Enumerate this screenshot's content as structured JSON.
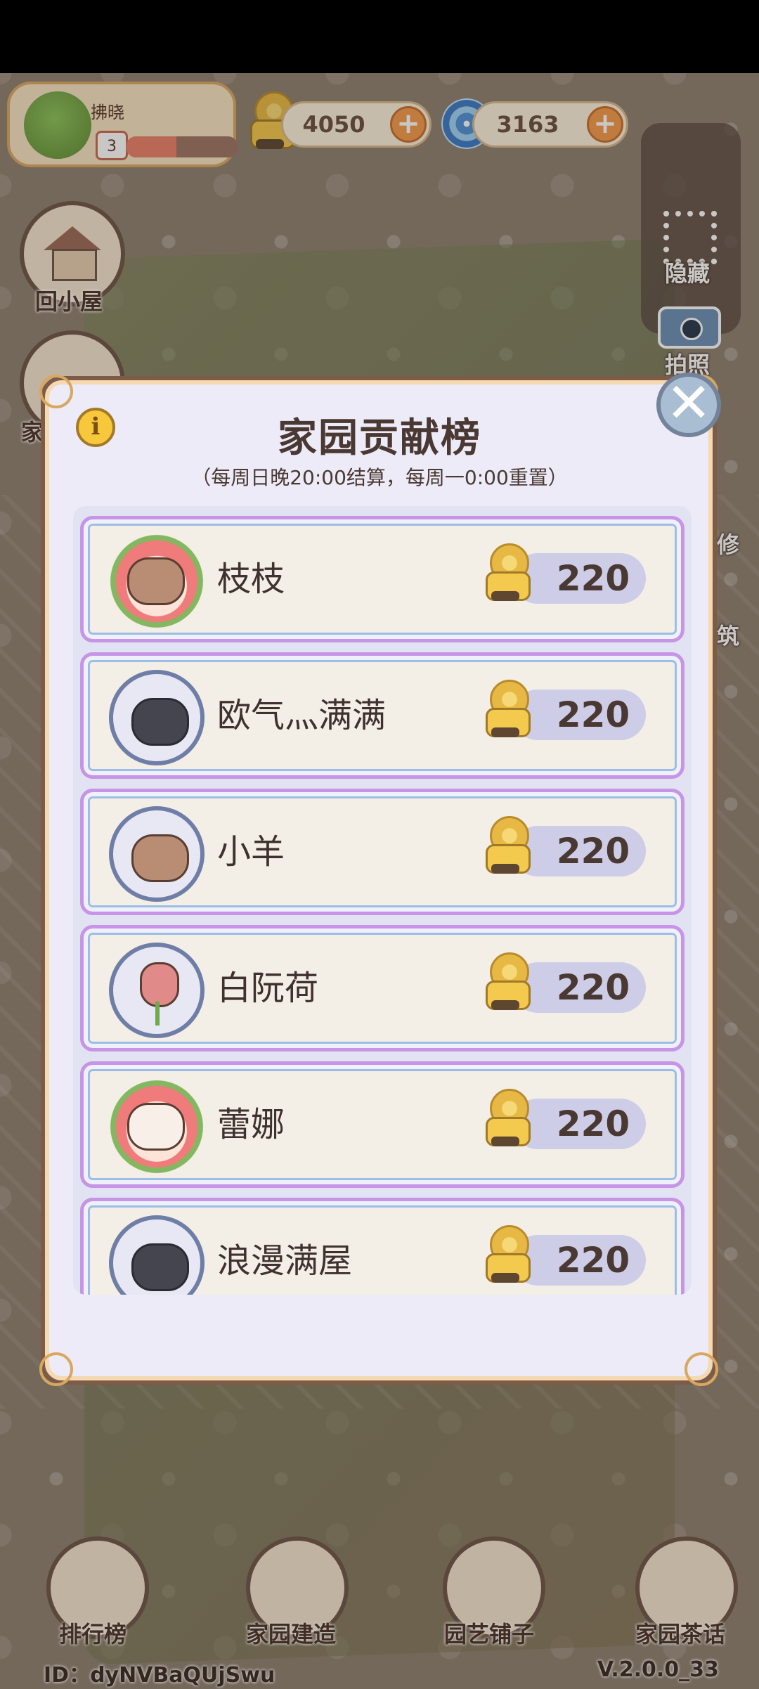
{
  "player": {
    "name": "拂晓",
    "level": "3",
    "xp_fraction": 0.45
  },
  "currencies": [
    {
      "icon": "snail-coin-icon",
      "value": "4050"
    },
    {
      "icon": "swirl-gem-icon",
      "value": "3163"
    }
  ],
  "left_buttons": {
    "home_label": "回小屋",
    "partial_label": "家"
  },
  "right_buttons": {
    "hide_label": "隐藏",
    "photo_label": "拍照",
    "partial_1": "修",
    "partial_2": "筑"
  },
  "dialog": {
    "title": "家园贡献榜",
    "subtitle": "（每周日晚20:00结算，每周一0:00重置）",
    "info_glyph": "i",
    "close_glyph": "✕",
    "rows": [
      {
        "name": "枝枝",
        "score": "220",
        "avatar": "bear-wreath"
      },
      {
        "name": "欧气灬满满",
        "score": "220",
        "avatar": "penguin"
      },
      {
        "name": "小羊",
        "score": "220",
        "avatar": "bear"
      },
      {
        "name": "白阮荷",
        "score": "220",
        "avatar": "tulip"
      },
      {
        "name": "蕾娜",
        "score": "220",
        "avatar": "sheep-wreath"
      },
      {
        "name": "浪漫满屋",
        "score": "220",
        "avatar": "penguin"
      }
    ]
  },
  "bottom_nav": [
    {
      "label": "排行榜",
      "icon": "podium-icon"
    },
    {
      "label": "家园建造",
      "icon": "brick-trowel-icon"
    },
    {
      "label": "园艺铺子",
      "icon": "flower-basket-icon"
    },
    {
      "label": "家园茶话",
      "icon": "chat-bubbles-icon"
    }
  ],
  "footer": {
    "id_text": "ID：dyNVBaQUjSwu",
    "version": "V.2.0.0_33"
  },
  "colors": {
    "accent_orange": "#f39b4c",
    "dialog_bg": "#ecebf7",
    "row_border": "#c794e6"
  }
}
